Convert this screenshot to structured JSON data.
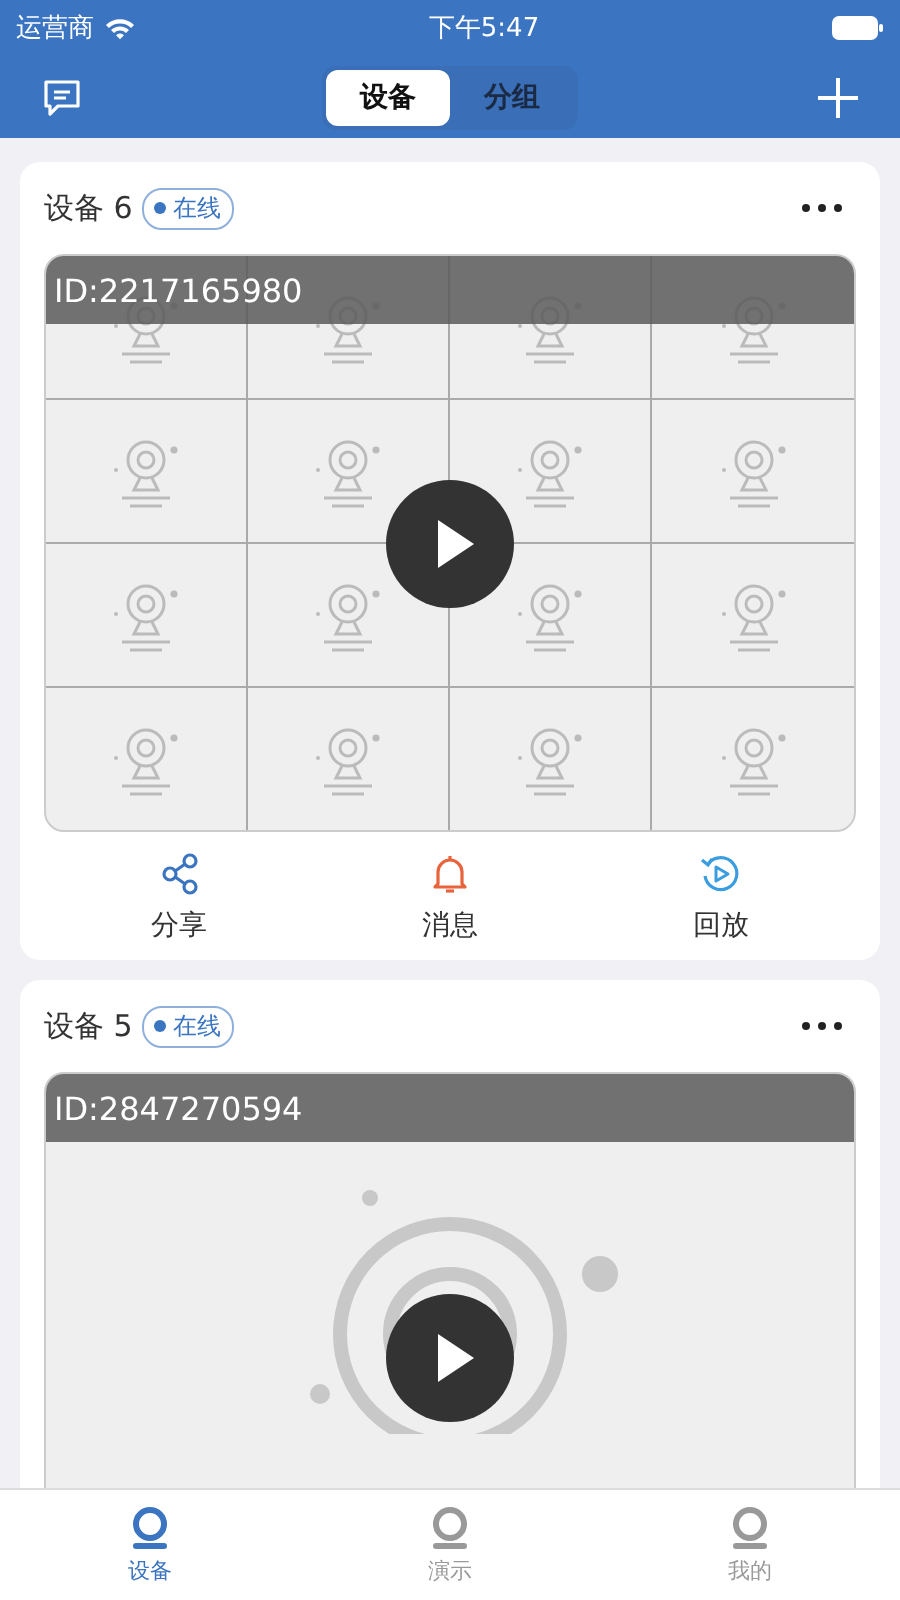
{
  "status_bar": {
    "carrier": "运营商",
    "time": "下午5:47"
  },
  "segments": [
    {
      "label": "设备",
      "selected": true
    },
    {
      "label": "分组",
      "selected": false
    }
  ],
  "devices": [
    {
      "name": "设备 6",
      "status": "在线",
      "online": true,
      "id": "ID:2217165980",
      "kind": "grid",
      "actions": [
        {
          "label": "分享",
          "kind": "share"
        },
        {
          "label": "消息",
          "kind": "alert"
        },
        {
          "label": "回放",
          "kind": "replay"
        }
      ]
    },
    {
      "name": "设备 5",
      "status": "在线",
      "online": true,
      "id": "ID:2847270594",
      "kind": "single"
    }
  ],
  "tab_bar": [
    {
      "label": "设备",
      "selected": true
    },
    {
      "label": "演示",
      "selected": false
    },
    {
      "label": "我的",
      "selected": false
    }
  ]
}
